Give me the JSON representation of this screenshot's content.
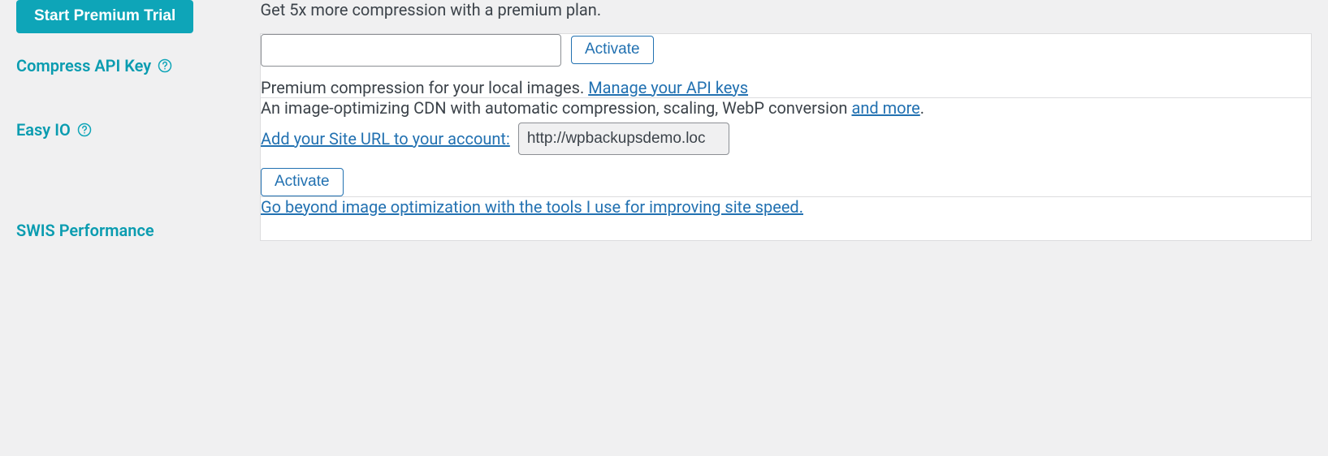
{
  "trial_button": "Start Premium Trial",
  "trial_desc": "Get 5x more compression with a premium plan.",
  "compress_api": {
    "label": "Compress API Key",
    "activate_btn": "Activate",
    "desc_prefix": "Premium compression for your local images. ",
    "manage_link": "Manage your API keys"
  },
  "easy_io": {
    "label": "Easy IO",
    "desc_prefix": "An image-optimizing CDN with automatic compression, scaling, WebP conversion ",
    "and_more": "and more",
    "add_url_text": "Add your Site URL to your account:",
    "site_url": "http://wpbackupsdemo.loc",
    "activate_btn": "Activate"
  },
  "swis": {
    "label": "SWIS Performance",
    "link_text": "Go beyond image optimization with the tools I use for improving site speed."
  }
}
